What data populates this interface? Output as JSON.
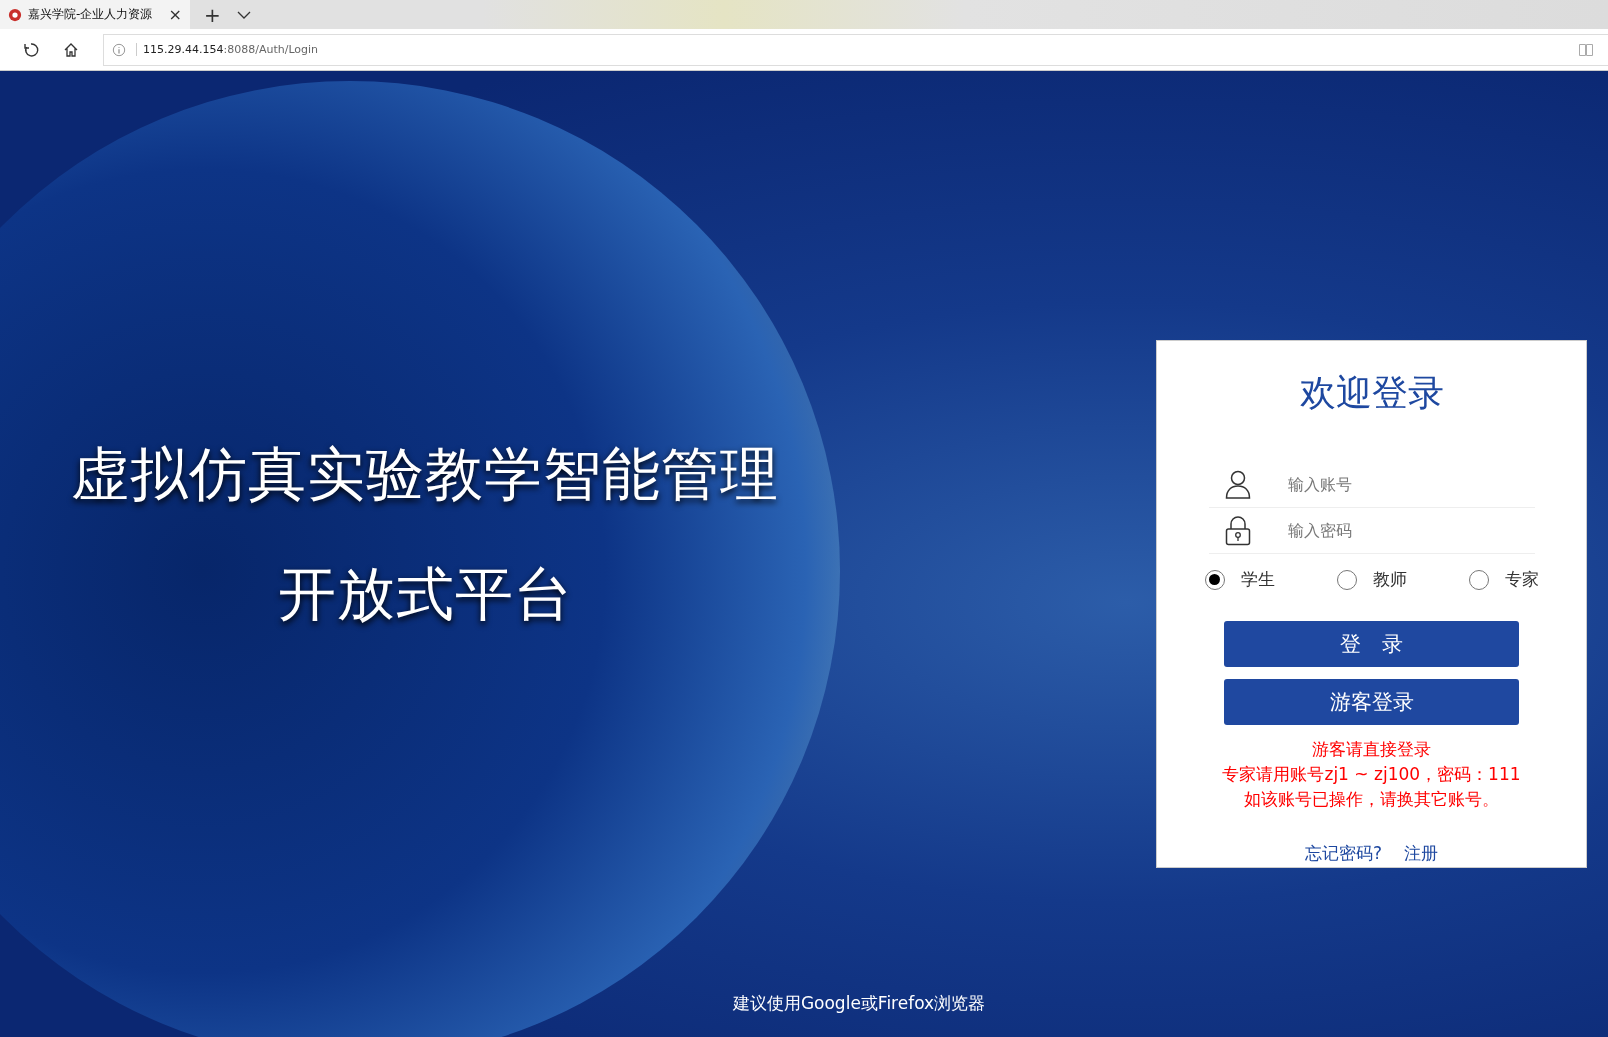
{
  "browser": {
    "tab": {
      "title": "嘉兴学院-企业人力资源",
      "close": "×"
    },
    "new_tab": "+",
    "address": {
      "host": "115.29.44.154",
      "path": ":8088/Auth/Login"
    }
  },
  "hero": {
    "title_lines": [
      "虚拟仿真实验教学智能管理",
      "开放式平台"
    ]
  },
  "login": {
    "title": "欢迎登录",
    "account": {
      "placeholder": "输入账号"
    },
    "password": {
      "placeholder": "输入密码"
    },
    "roles": [
      {
        "label": "学生",
        "selected": true
      },
      {
        "label": "教师",
        "selected": false
      },
      {
        "label": "专家",
        "selected": false
      }
    ],
    "login_button": "登　录",
    "guest_button": "游客登录",
    "notes": [
      "游客请直接登录",
      "专家请用账号zj1 ~ zj100，密码：111",
      "如该账号已操作，请换其它账号。"
    ],
    "links": [
      "忘记密码?",
      "注册"
    ]
  },
  "footer": "建议使用Google或Firefox浏览器"
}
